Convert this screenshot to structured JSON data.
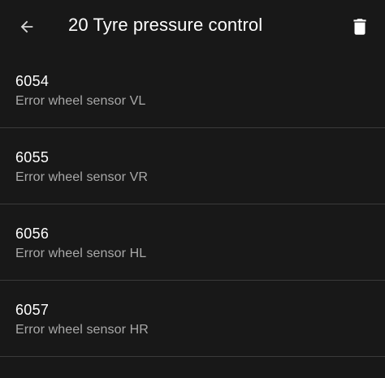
{
  "header": {
    "title": "20 Tyre pressure control",
    "back_icon": "arrow-left-icon",
    "delete_icon": "trash-icon"
  },
  "faults": [
    {
      "code": "6054",
      "description": "Error wheel sensor VL"
    },
    {
      "code": "6055",
      "description": "Error wheel sensor VR"
    },
    {
      "code": "6056",
      "description": "Error wheel sensor HL"
    },
    {
      "code": "6057",
      "description": "Error wheel sensor HR"
    }
  ],
  "colors": {
    "background": "#181818",
    "primary_text": "#ffffff",
    "secondary_text": "#a9a9a9",
    "divider": "#3a3a3a"
  }
}
